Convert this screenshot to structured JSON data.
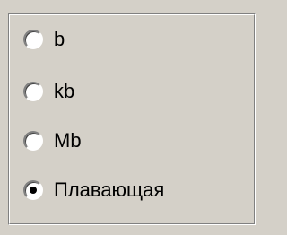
{
  "units_group": {
    "options": [
      {
        "label": "b",
        "selected": false
      },
      {
        "label": "kb",
        "selected": false
      },
      {
        "label": "Mb",
        "selected": false
      },
      {
        "label": "Плавающая",
        "selected": true
      }
    ]
  }
}
